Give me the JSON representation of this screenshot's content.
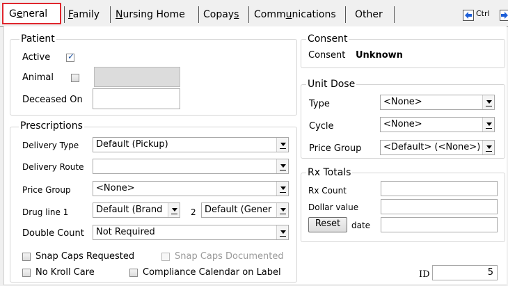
{
  "tabs": [
    {
      "label": "General",
      "mnemonic": "e",
      "active": true
    },
    {
      "label": "Family",
      "mnemonic": "F"
    },
    {
      "label": "Nursing Home",
      "mnemonic": "N"
    },
    {
      "label": "Copays",
      "mnemonic": "s"
    },
    {
      "label": "Communications",
      "mnemonic": "u"
    },
    {
      "label": "Other",
      "mnemonic": ""
    }
  ],
  "nav": {
    "ctrl_label": "Ctrl"
  },
  "patient": {
    "title": "Patient",
    "active_label": "Active",
    "active_checked": true,
    "animal_label": "Animal",
    "animal_checked": false,
    "animal_value": "",
    "deceased_label": "Deceased On",
    "deceased_value": ""
  },
  "prescriptions": {
    "title": "Prescriptions",
    "delivery_type_label": "Delivery Type",
    "delivery_type_value": "Default (Pickup)",
    "delivery_route_label": "Delivery Route",
    "delivery_route_value": "",
    "price_group_label": "Price Group",
    "price_group_value": "<None>",
    "drug_line_label": "Drug line 1",
    "drug_line1_value": "Default (Brand",
    "drug_line2_label": "2",
    "drug_line2_value": "Default (Gener",
    "double_count_label": "Double Count",
    "double_count_value": "Not Required"
  },
  "options": {
    "snap_caps_requested": "Snap Caps Requested",
    "snap_caps_requested_checked": false,
    "snap_caps_documented": "Snap Caps Documented",
    "snap_caps_documented_checked": false,
    "no_kroll_care": "No Kroll Care",
    "no_kroll_care_checked": false,
    "compliance_calendar": "Compliance Calendar on Label",
    "compliance_calendar_checked": false
  },
  "consent": {
    "title": "Consent",
    "label": "Consent",
    "value": "Unknown"
  },
  "unit_dose": {
    "title": "Unit Dose",
    "type_label": "Type",
    "type_value": "<None>",
    "cycle_label": "Cycle",
    "cycle_value": "<None>",
    "price_group_label": "Price Group",
    "price_group_value": "<Default> (<None>)"
  },
  "rx_totals": {
    "title": "Rx Totals",
    "rx_count_label": "Rx Count",
    "rx_count_value": "",
    "dollar_value_label": "Dollar value",
    "dollar_value_value": "",
    "reset_label": "Reset",
    "date_label": "date",
    "date_value": ""
  },
  "id": {
    "label": "ID",
    "value": "5"
  },
  "colors": {
    "active_tab_outline": "#e0262d",
    "nav_arrow": "#1e5fd8"
  }
}
